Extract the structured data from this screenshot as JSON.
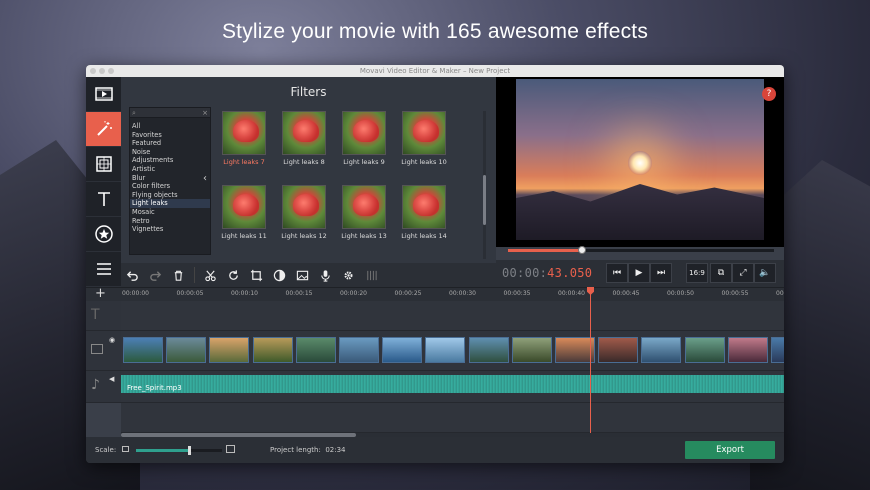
{
  "headline": "Stylize your movie with 165 awesome effects",
  "window": {
    "title": "Movavi Video Editor & Maker – New Project"
  },
  "sidebar": {
    "items": [
      {
        "name": "import-media-icon"
      },
      {
        "name": "filters-magic-wand-icon",
        "active": true
      },
      {
        "name": "transitions-icon"
      },
      {
        "name": "titles-text-icon"
      },
      {
        "name": "stickers-star-icon"
      },
      {
        "name": "more-tools-list-icon"
      }
    ]
  },
  "filters": {
    "title": "Filters",
    "search_clear": "×",
    "categories": [
      "All",
      "Favorites",
      "Featured",
      "Noise",
      "Adjustments",
      "Artistic",
      "Blur",
      "Color filters",
      "Flying objects",
      "Light leaks",
      "Mosaic",
      "Retro",
      "Vignettes"
    ],
    "selected_category": "Light leaks",
    "thumbnails": [
      {
        "label": "Light leaks 7",
        "active": true
      },
      {
        "label": "Light leaks 8"
      },
      {
        "label": "Light leaks 9"
      },
      {
        "label": "Light leaks 10"
      },
      {
        "label": "Light leaks 11"
      },
      {
        "label": "Light leaks 12"
      },
      {
        "label": "Light leaks 13"
      },
      {
        "label": "Light leaks 14"
      }
    ]
  },
  "preview": {
    "help_label": "?",
    "progress_fraction": 0.28
  },
  "player": {
    "timecode_prefix": "00:00:",
    "timecode_hot": "43.050",
    "aspect_label": "16:9"
  },
  "timeline": {
    "ticks": [
      "00:00:00",
      "00:00:05",
      "00:00:10",
      "00:00:15",
      "00:00:20",
      "00:00:25",
      "00:00:30",
      "00:00:35",
      "00:00:40",
      "00:00:45",
      "00:00:50",
      "00:00:55",
      "00:01:0"
    ],
    "add_label": "+",
    "audio_clip": "Free_Spirit.mp3",
    "clip_count": 16
  },
  "bottom": {
    "scale_label": "Scale:",
    "zoom_fraction": 0.6,
    "project_length_label": "Project length:",
    "project_length_value": "02:34",
    "export_label": "Export"
  }
}
